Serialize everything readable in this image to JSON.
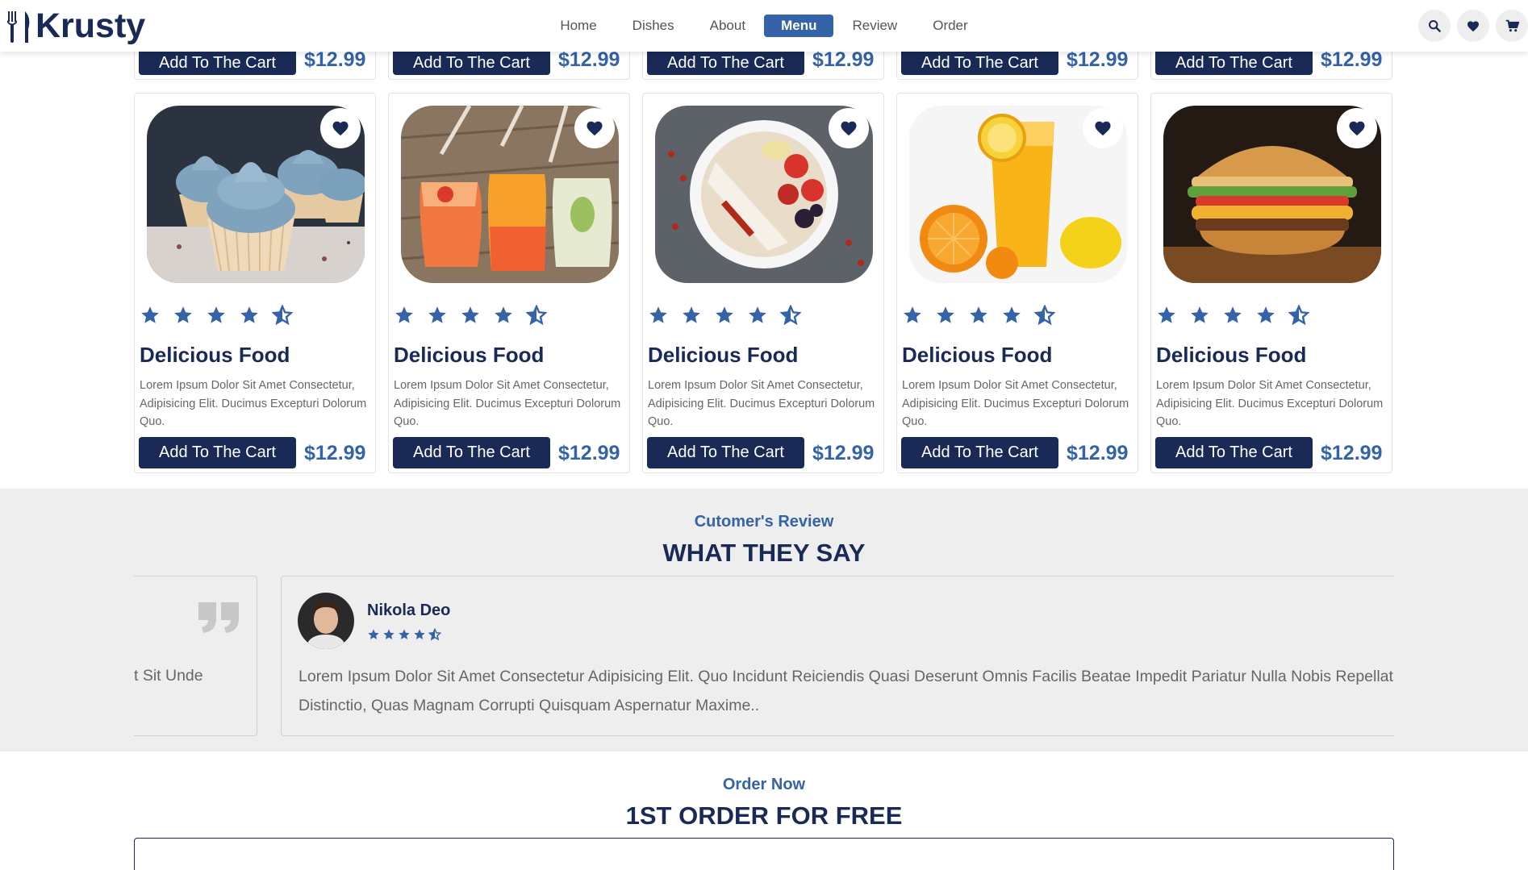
{
  "header": {
    "brand": "Krusty",
    "nav": [
      "Home",
      "Dishes",
      "About",
      "Menu",
      "Review",
      "Order"
    ],
    "active_nav": "Menu",
    "icons": [
      "search-icon",
      "heart-icon",
      "cart-icon"
    ]
  },
  "menu": {
    "top_row": [
      {
        "cart_label": "Add To The Cart",
        "price": "$12.99"
      },
      {
        "cart_label": "Add To The Cart",
        "price": "$12.99"
      },
      {
        "cart_label": "Add To The Cart",
        "price": "$12.99"
      },
      {
        "cart_label": "Add To The Cart",
        "price": "$12.99"
      },
      {
        "cart_label": "Add To The Cart",
        "price": "$12.99"
      }
    ],
    "items": [
      {
        "image": "blue-cupcakes",
        "rating": 4.5,
        "title": "Delicious Food",
        "desc": "Lorem Ipsum Dolor Sit Amet Consectetur, Adipisicing Elit. Ducimus Excepturi Dolorum Quo.",
        "cart_label": "Add To The Cart",
        "price": "$12.99"
      },
      {
        "image": "fruit-juices",
        "rating": 4.5,
        "title": "Delicious Food",
        "desc": "Lorem Ipsum Dolor Sit Amet Consectetur, Adipisicing Elit. Ducimus Excepturi Dolorum Quo.",
        "cart_label": "Add To The Cart",
        "price": "$12.99"
      },
      {
        "image": "smoothie-bowl",
        "rating": 4.5,
        "title": "Delicious Food",
        "desc": "Lorem Ipsum Dolor Sit Amet Consectetur, Adipisicing Elit. Ducimus Excepturi Dolorum Quo.",
        "cart_label": "Add To The Cart",
        "price": "$12.99"
      },
      {
        "image": "orange-juice",
        "rating": 4.5,
        "title": "Delicious Food",
        "desc": "Lorem Ipsum Dolor Sit Amet Consectetur, Adipisicing Elit. Ducimus Excepturi Dolorum Quo.",
        "cart_label": "Add To The Cart",
        "price": "$12.99"
      },
      {
        "image": "burger",
        "rating": 4.5,
        "title": "Delicious Food",
        "desc": "Lorem Ipsum Dolor Sit Amet Consectetur, Adipisicing Elit. Ducimus Excepturi Dolorum Quo.",
        "cart_label": "Add To The Cart",
        "price": "$12.99"
      }
    ]
  },
  "review": {
    "subheading": "Cutomer's Review",
    "heading": "WHAT THEY SAY",
    "prev_snippet": "t Sit Unde",
    "name": "Nikola Deo",
    "rating": 4.5,
    "text_line1": "Lorem Ipsum Dolor Sit Amet Consectetur Adipisicing Elit. Quo Incidunt Reiciendis Quasi Deserunt Omnis Facilis Beatae Impedit Pariatur Nulla Nobis Repellat",
    "text_line2": "Distinctio, Quas Magnam Corrupti Quisquam Aspernatur Maxime.."
  },
  "order": {
    "subheading": "Order Now",
    "heading": "1ST ORDER FOR FREE"
  },
  "colors": {
    "navy": "#192a56",
    "accent": "#3463a8",
    "section_bg": "#eeeeee"
  }
}
